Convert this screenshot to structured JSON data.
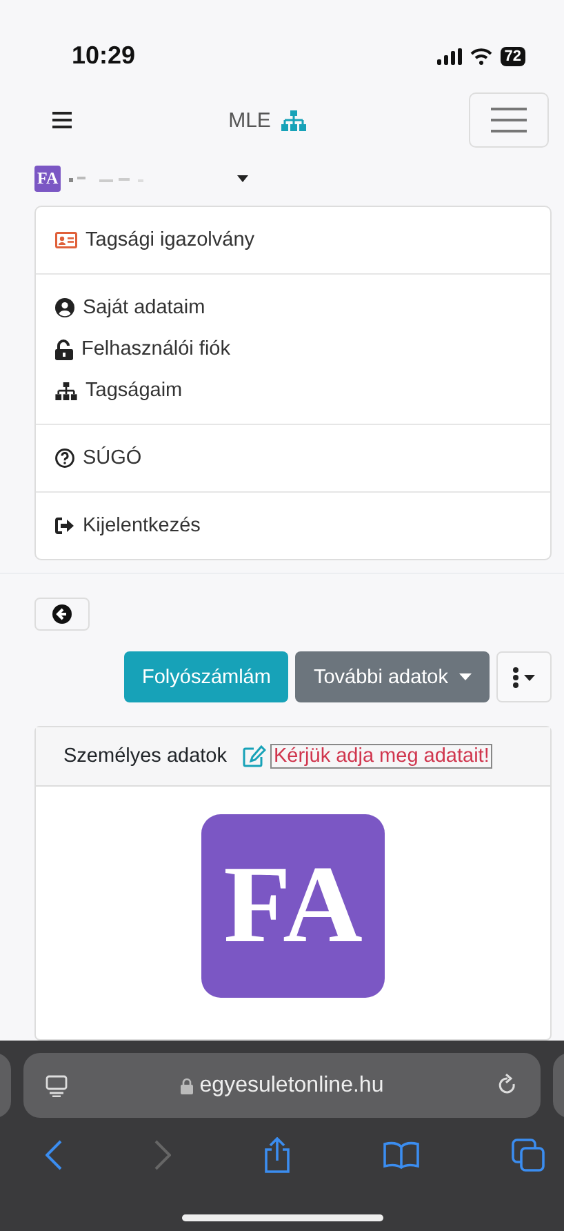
{
  "status_bar": {
    "time": "10:29",
    "battery": "72"
  },
  "navbar": {
    "brand": "MLE"
  },
  "user": {
    "initials": "FA"
  },
  "menu": {
    "groups": [
      [
        {
          "kind": "card",
          "label": "Tagsági igazolvány"
        }
      ],
      [
        {
          "kind": "user",
          "label": "Saját adataim"
        },
        {
          "kind": "lock",
          "label": "Felhasználói fiók"
        },
        {
          "kind": "sitemap",
          "label": "Tagságaim"
        }
      ],
      [
        {
          "kind": "help",
          "label": "SÚGÓ"
        }
      ],
      [
        {
          "kind": "logout",
          "label": "Kijelentkezés"
        }
      ]
    ]
  },
  "actions": [
    {
      "kind": "primary",
      "label": "Folyószámlám",
      "dropdown": false
    },
    {
      "kind": "secondary",
      "label": "További adatok",
      "dropdown": true
    }
  ],
  "card": {
    "title": "Személyes adatok",
    "alert": "Kérjük adja meg adatait!",
    "avatar": "FA"
  },
  "browser": {
    "url": "egyesuletonline.hu",
    "nav": [
      {
        "kind": "back",
        "disabled": false
      },
      {
        "kind": "forward",
        "disabled": true
      }
    ]
  }
}
